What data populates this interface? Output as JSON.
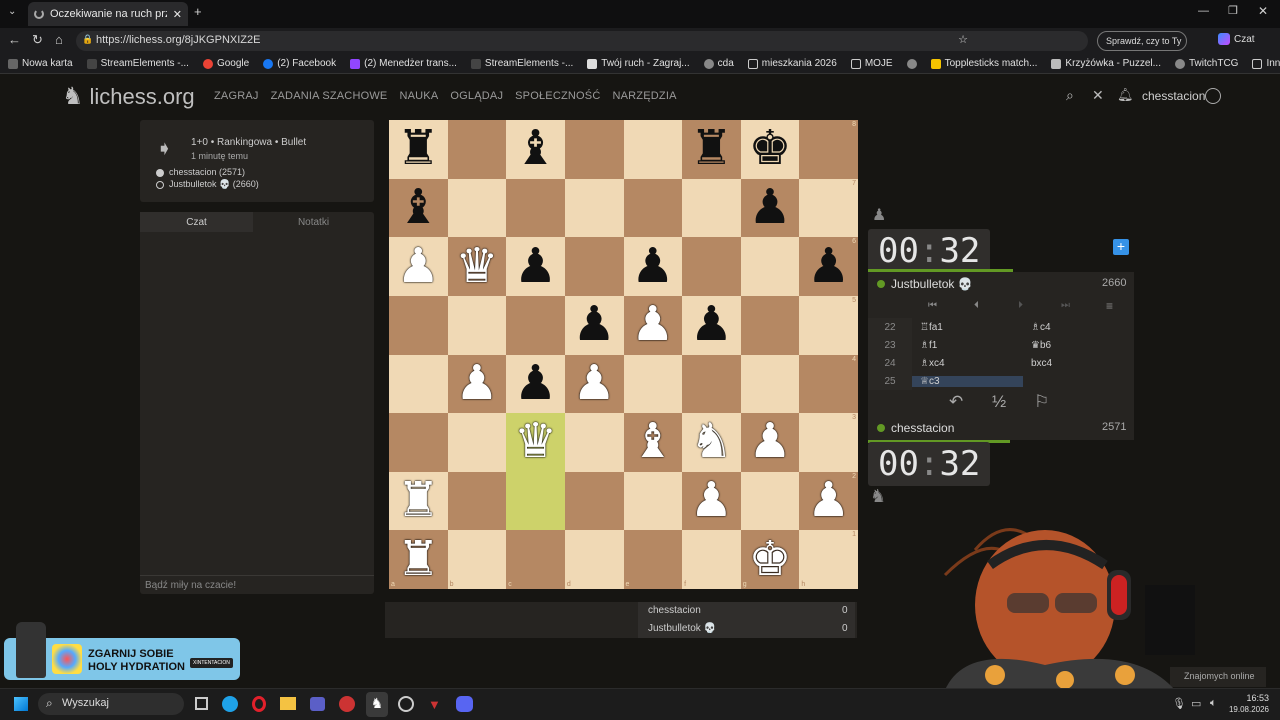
{
  "browser": {
    "tab_title": "Oczekiwanie na ruch przeciwn",
    "url": "https://lichess.org/8jJKGPNXIZ2E",
    "profile_button": "Sprawdź, czy to Ty",
    "copilot_label": "Czat",
    "bookmarks": [
      "Nowa karta",
      "StreamElements -...",
      "Google",
      "(2) Facebook",
      "(2) Menedżer trans...",
      "StreamElements -...",
      "Twój ruch - Zagraj...",
      "cda",
      "mieszkania 2026",
      "MOJE",
      "",
      "Topplesticks match...",
      "Krzyżówka - Puzzel...",
      "TwitchTCG"
    ],
    "other_favorites": "Inne ulubione"
  },
  "header": {
    "logo": "lichess.org",
    "nav": [
      "ZAGRAJ",
      "ZADANIA SZACHOWE",
      "NAUKA",
      "OGLĄDAJ",
      "SPOŁECZNOŚĆ",
      "NARZĘDZIA"
    ],
    "username": "chesstacion"
  },
  "game": {
    "mode": "1+0 • Rankingowa • Bullet",
    "time_ago": "1 minutę temu",
    "white_player": "chesstacion (2571)",
    "black_player": "Justbulletok 💀 (2660)"
  },
  "chat": {
    "tab_chat": "Czat",
    "tab_notes": "Notatki",
    "placeholder": "Bądź miły na czacie!"
  },
  "board": {
    "files": [
      "a",
      "b",
      "c",
      "d",
      "e",
      "f",
      "g",
      "h"
    ],
    "ranks": [
      "8",
      "7",
      "6",
      "5",
      "4",
      "3",
      "2",
      "1"
    ],
    "rows": [
      [
        "r",
        "",
        "b",
        "",
        "",
        "r",
        "k",
        ""
      ],
      [
        "b",
        "",
        "",
        "",
        "",
        "",
        "p",
        ""
      ],
      [
        "P",
        "Q",
        "p",
        "",
        "p",
        "",
        "",
        "p"
      ],
      [
        "",
        "",
        "",
        "p",
        "P",
        "p",
        "",
        ""
      ],
      [
        "",
        "P",
        "p",
        "P",
        "",
        "",
        "",
        ""
      ],
      [
        "",
        "",
        "Q",
        "",
        "B",
        "N",
        "P",
        ""
      ],
      [
        "R",
        "",
        "",
        "",
        "",
        "P",
        "",
        "P"
      ],
      [
        "R",
        "",
        "",
        "",
        "",
        "",
        "K",
        ""
      ]
    ],
    "highlight": [
      "c3",
      "c2"
    ]
  },
  "opponent": {
    "clock_min": "00",
    "clock_sec": "32",
    "name": "Justbulletok 💀",
    "rating": "2660"
  },
  "player": {
    "clock_min": "00",
    "clock_sec": "32",
    "name": "chesstacion",
    "rating": "2571"
  },
  "moves": [
    {
      "num": "22",
      "white": "♖fa1",
      "black": "♗c4"
    },
    {
      "num": "23",
      "white": "♗f1",
      "black": "♛b6"
    },
    {
      "num": "24",
      "white": "♗xc4",
      "black": "bxc4"
    },
    {
      "num": "25",
      "white": "♕c3",
      "black": ""
    }
  ],
  "controls": {
    "takeback": "↶",
    "draw": "½",
    "resign": "⚐"
  },
  "crosstable": [
    {
      "name": "chesstacion",
      "score": "0"
    },
    {
      "name": "Justbulletok 💀",
      "score": "0"
    }
  ],
  "friends_online": "Znajomych online",
  "ad": {
    "line1": "ZGARNIJ SOBIE",
    "line2": "HOLY HYDRATION",
    "tag": "XINTENTACION"
  },
  "taskbar": {
    "search": "Wyszukaj",
    "time": "16:53",
    "date": "19.08.2026"
  },
  "colors": {
    "light_square": "#f0d9b5",
    "dark_square": "#b58863",
    "highlight": "#cdd26a",
    "online": "#629924"
  }
}
